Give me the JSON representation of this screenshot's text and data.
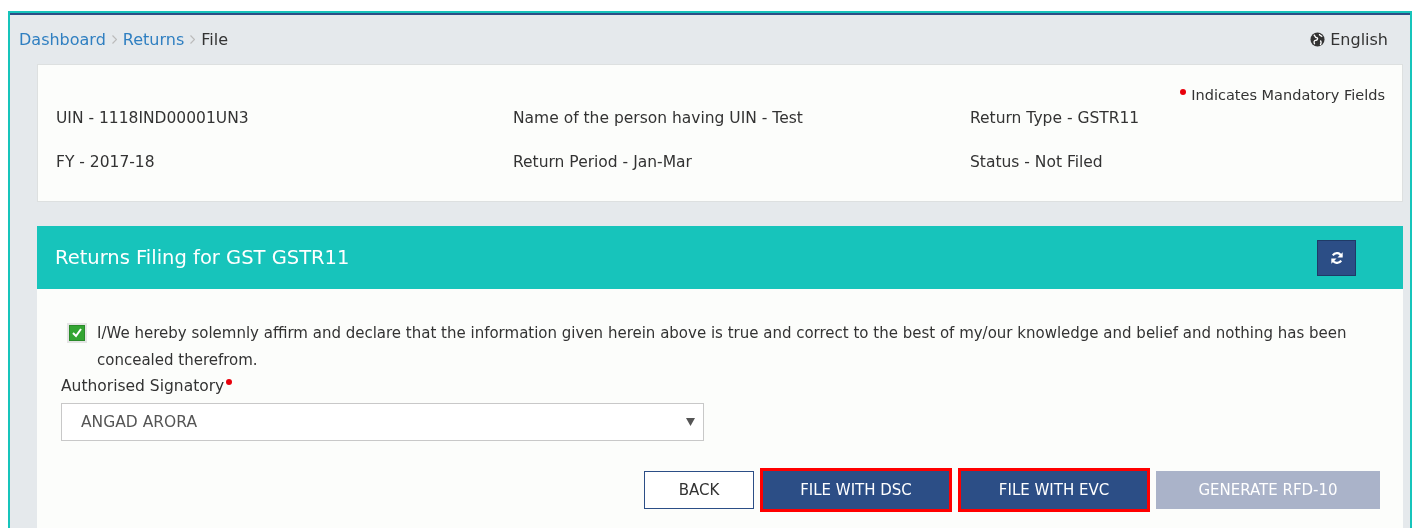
{
  "breadcrumb": [
    {
      "label": "Dashboard",
      "kind": "link"
    },
    {
      "label": "Returns",
      "kind": "link"
    },
    {
      "label": "File",
      "kind": "current"
    }
  ],
  "language": {
    "label": "English"
  },
  "mandatory_note": "Indicates Mandatory Fields",
  "info": [
    {
      "text": "UIN - 1118IND00001UN3"
    },
    {
      "text": "Name of the person having UIN - Test"
    },
    {
      "text": "Return Type - GSTR11"
    },
    {
      "text": "FY - 2017-18"
    },
    {
      "text": "Return Period - Jan-Mar"
    },
    {
      "text": "Status - Not Filed"
    }
  ],
  "panel": {
    "title": "Returns Filing for GST GSTR11"
  },
  "declaration": {
    "checked": true,
    "text": "I/We hereby solemnly affirm and declare that the information given herein above is true and correct to the best of my/our knowledge and belief and nothing has been concealed therefrom."
  },
  "signatory": {
    "label": "Authorised Signatory",
    "required": true,
    "value": "ANGAD ARORA"
  },
  "buttons": [
    {
      "label": "BACK",
      "kind": "outline",
      "disabled": false,
      "highlighted": false
    },
    {
      "label": "FILE WITH DSC",
      "kind": "primary",
      "disabled": false,
      "highlighted": true
    },
    {
      "label": "FILE WITH EVC",
      "kind": "primary",
      "disabled": false,
      "highlighted": true
    },
    {
      "label": "GENERATE RFD-10",
      "kind": "primary",
      "disabled": true,
      "highlighted": false
    }
  ]
}
